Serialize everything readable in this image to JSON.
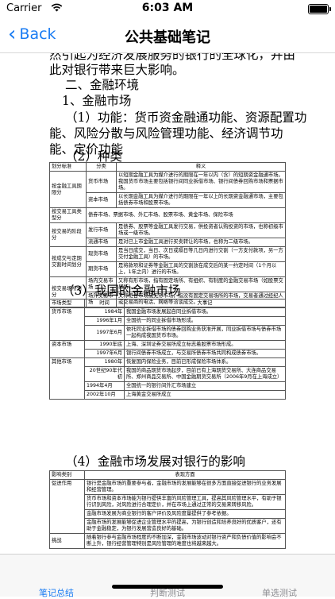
{
  "status": {
    "carrier": "Carrier",
    "time": "6:03 AM"
  },
  "nav": {
    "back_label": "Back",
    "title": "公共基础笔记"
  },
  "content": {
    "p1a": "然引起为经济发展服务的银行的全球化，并由",
    "p1b": "此对银行带来巨大影响。",
    "h2": "二、金融环境",
    "h3": "1、金融市场",
    "f1": "（1）功能：货币资金融通功能、资源配置功",
    "f2": "能、风险分散与风险管理功能、经济调节功",
    "f3": "能、定价功能",
    "h_types": "（2）种类",
    "table1": {
      "headers": [
        "划分标准",
        "分类",
        "释义"
      ],
      "rows": [
        [
          "按金融工具期限分",
          "货币市场",
          "以短期金融工具为媒介进行的期限在一年以内（含）的短期资金融通市场。我国货币市场主要包括银行间同业拆借市场、银行间债券回购市场和票据市场。"
        ],
        [
          "",
          "资本市场",
          "以长期金融工具为媒介进行的期限在一年以上的长期资金融通市场，主要包括债券市场和股票市场。"
        ],
        [
          "按交易工具类型分",
          "债券市场、票据市场、外汇市场、股票市场、黄金市场、保险市场",
          ""
        ],
        [
          "按交易的阶段分",
          "发行市场",
          "是债券、股票等金融工具发行交易，供投资者认购投资的市场，也称初级市场或一级市场。"
        ],
        [
          "",
          "流通市场",
          "是对已上市金融工具进行买卖转让的市场，也称为二级市场。"
        ],
        [
          "按成交与定期交割时间划分",
          "现货市场",
          "是当日成交，当日、次日或隔日等几日内进行交割（一方支付款项，另一方交付金融工具）的市场。"
        ],
        [
          "",
          "期货市场",
          "是将款项和证券等金融工具的交割放在成交后的某一约定时间（1个月以上，1年之内）进行的市场。"
        ],
        [
          "按交易场所划分",
          "场内交易市场",
          "又称有形市场，指有固定场所、有组织、有制度的金融交易市场（如股票交易所）。"
        ],
        [
          "",
          "场外交易市场",
          "又称柜台市场或无形市场，指没有固定交易场所的市场，交易者通过经纪人或交易商的电话、网络等洽谈成交。"
        ]
      ]
    },
    "h_china": "（3）我国的金融市场",
    "table2": {
      "headers": [
        "市场类型",
        "时间",
        "大事记"
      ],
      "rows": [
        [
          "货币市场",
          "1984年",
          "我国金融市场发展起自同业拆借市场。"
        ],
        [
          "",
          "1996年1月",
          "全国统一的同业拆借市场形成。"
        ],
        [
          "",
          "1997年6月",
          "依托同业拆借市场的债券回购业务获准开展，同业拆借市场与债券市场一起构成我国货币市场。"
        ],
        [
          "资本市场",
          "1990年底",
          "上海、深圳证券交易所成立标志着股票市场形成。"
        ],
        [
          "",
          "1997年6月",
          "银行间债券市场成立，与交易所债券市场共同构成债券市场。"
        ],
        [
          "其他市场",
          "1980年",
          "恢复国内保险业务，目前已形成保险市场体系。"
        ],
        [
          "",
          "20世纪90年代初",
          "我国的商品期货市场起步，目前已有上海期货交易所、大连商品交易所、郑州商品交易所、中国金融期货交易所（2006年9月在上海成立）"
        ],
        [
          "",
          "1994年4月",
          "全国统一的银行间外汇市场建立"
        ],
        [
          "",
          "2002年10月",
          "上海黄金交易所成立"
        ]
      ]
    },
    "h_impact": "（4）金融市场发展对银行的影响",
    "table3": {
      "headers": [
        "影响类别",
        "表现方面"
      ],
      "rows": [
        [
          "促进作用",
          "银行是金融市场的重要参与者，金融市场的发展能够在很多方面直接促进银行的业务发展和经营管理。"
        ],
        [
          "",
          "货币市场和资本市场能为银行提供丰富的风险管理工具，提高其风险管理水平，有助于银行识别风险，对风险进行合理定价，并在市场上通过正常的交易来转移风险。"
        ],
        [
          "",
          "金融市场发展为商业银行的客户评价及风险度量提供了参考依据。"
        ],
        [
          "",
          "金融市场的发展能够促进企业管理水平的提高，为银行创造和培养良好的优质客户，还有助于金融稳定，为银行发展营造良好的基础。"
        ],
        [
          "挑战",
          "随着银行参与金融市场程度的不断加深，金融市场波动对银行资产和负债价值的影响会不断上升，银行经营管理特别是风险管理的难度也将越来越大。"
        ]
      ]
    }
  },
  "tabs": [
    {
      "label": "笔记总结",
      "active": true
    },
    {
      "label": "判断测试",
      "active": false
    },
    {
      "label": "单选测试",
      "active": false
    }
  ],
  "colors": {
    "accent": "#1a7cf3",
    "inactive_tab": "#8e8e93"
  }
}
